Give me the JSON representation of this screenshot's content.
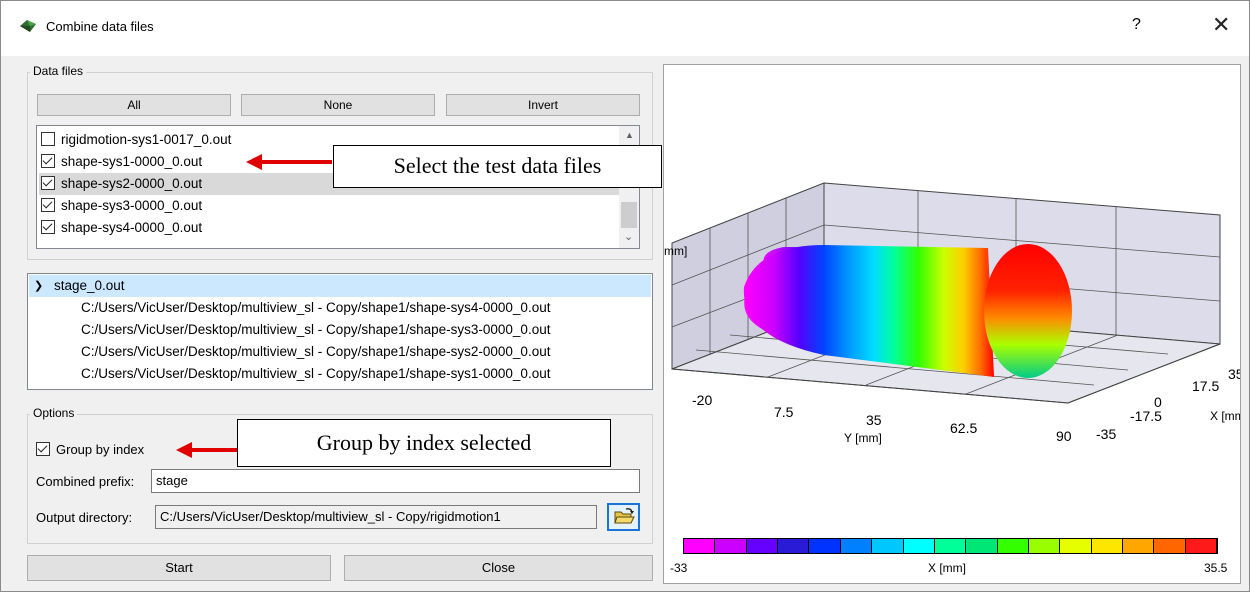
{
  "window": {
    "title": "Combine data files",
    "help_label": "?",
    "close_label": "✕"
  },
  "data_files": {
    "group_label": "Data files",
    "buttons": {
      "all": "All",
      "none": "None",
      "invert": "Invert"
    },
    "items": [
      {
        "label": "rigidmotion-sys1-0017_0.out",
        "checked": false
      },
      {
        "label": "shape-sys1-0000_0.out",
        "checked": true
      },
      {
        "label": "shape-sys2-0000_0.out",
        "checked": true
      },
      {
        "label": "shape-sys3-0000_0.out",
        "checked": true
      },
      {
        "label": "shape-sys4-0000_0.out",
        "checked": true
      }
    ]
  },
  "tree": {
    "root": "stage_0.out",
    "children": [
      "C:/Users/VicUser/Desktop/multiview_sl - Copy/shape1/shape-sys4-0000_0.out",
      "C:/Users/VicUser/Desktop/multiview_sl - Copy/shape1/shape-sys3-0000_0.out",
      "C:/Users/VicUser/Desktop/multiview_sl - Copy/shape1/shape-sys2-0000_0.out",
      "C:/Users/VicUser/Desktop/multiview_sl - Copy/shape1/shape-sys1-0000_0.out"
    ]
  },
  "options": {
    "group_label": "Options",
    "group_by_index_label": "Group by index",
    "group_by_index_checked": true,
    "combined_prefix_label": "Combined prefix:",
    "combined_prefix_value": "stage",
    "output_directory_label": "Output directory:",
    "output_directory_value": "C:/Users/VicUser/Desktop/multiview_sl - Copy/rigidmotion1",
    "browse_icon": "folder-open-icon"
  },
  "footer": {
    "start_label": "Start",
    "close_label": "Close"
  },
  "annotations": {
    "select_files": "Select the test data files",
    "group_by_index": "Group by index selected"
  },
  "plot": {
    "y_axis_label": "Y [mm]",
    "y_ticks": [
      "-20",
      "7.5",
      "35",
      "62.5",
      "90"
    ],
    "x_axis_label": "X [mm",
    "x_ticks": [
      "-35",
      "-17.5",
      "0",
      "17.5",
      "35"
    ],
    "z_axis_label": "mm]",
    "colorbar": {
      "min_label": "-33",
      "max_label": "35.5",
      "label": "X [mm]",
      "colors": [
        "#ff00ff",
        "#cc00ff",
        "#6600ff",
        "#2a1bd6",
        "#0033ff",
        "#0080ff",
        "#00c8ff",
        "#00ffff",
        "#00ff99",
        "#00e676",
        "#33ff00",
        "#99ff00",
        "#e6ff00",
        "#ffe600",
        "#ffa600",
        "#ff6600",
        "#ff1a1a"
      ]
    },
    "colors": {
      "accent_annotation_arrow": "#e00000",
      "selected_tree_row": "#cce8ff"
    }
  }
}
